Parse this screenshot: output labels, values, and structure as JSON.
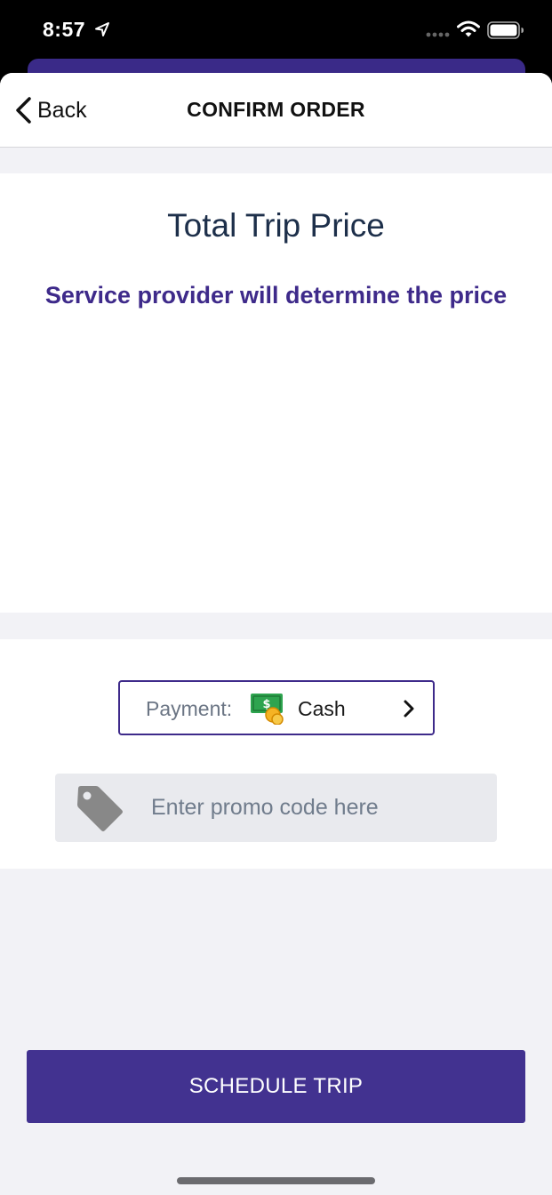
{
  "status_bar": {
    "time": "8:57",
    "icons": [
      "location-arrow-icon",
      "signal-dots-icon",
      "wifi-icon",
      "battery-icon"
    ]
  },
  "nav": {
    "back_label": "Back",
    "title": "CONFIRM ORDER"
  },
  "price": {
    "title": "Total Trip Price",
    "subtitle": "Service provider will determine the price"
  },
  "payment": {
    "label": "Payment:",
    "method": "Cash",
    "icon": "cash-money-icon"
  },
  "promo": {
    "placeholder": "Enter promo code here",
    "value": "",
    "icon": "tag-icon"
  },
  "actions": {
    "schedule_label": "SCHEDULE TRIP"
  },
  "colors": {
    "accent": "#3e2a8a",
    "button": "#423290",
    "title_text": "#1d2f4a",
    "background": "#f2f2f6"
  }
}
